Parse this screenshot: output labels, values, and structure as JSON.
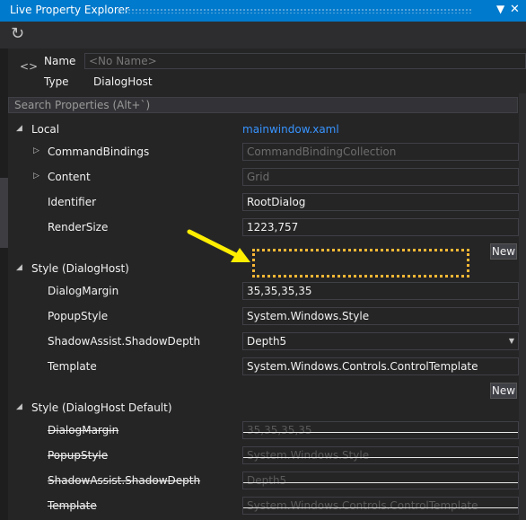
{
  "window": {
    "title": "Live Property Explorer"
  },
  "toolbar": {
    "refresh_icon": "refresh-icon"
  },
  "header": {
    "name_label": "Name",
    "name_placeholder": "<No Name>",
    "type_label": "Type",
    "type_value": "DialogHost"
  },
  "search": {
    "placeholder": "Search Properties (Alt+`)"
  },
  "local": {
    "label": "Local",
    "source_link": "mainwindow.xaml",
    "props": [
      {
        "name": "CommandBindings",
        "value": "CommandBindingCollection"
      },
      {
        "name": "Content",
        "value": "Grid"
      },
      {
        "name": "Identifier",
        "value": "RootDialog"
      },
      {
        "name": "RenderSize",
        "value": "1223,757"
      }
    ],
    "new_label": "New"
  },
  "style": {
    "label": "Style (DialogHost)",
    "props": [
      {
        "name": "DialogMargin",
        "value": "35,35,35,35"
      },
      {
        "name": "PopupStyle",
        "value": "System.Windows.Style"
      },
      {
        "name": "ShadowAssist.ShadowDepth",
        "value": "Depth5"
      },
      {
        "name": "Template",
        "value": "System.Windows.Controls.ControlTemplate"
      }
    ],
    "new_label": "New"
  },
  "style_default": {
    "label": "Style (DialogHost Default)",
    "props": [
      {
        "name": "DialogMargin",
        "value": "35,35,35,35"
      },
      {
        "name": "PopupStyle",
        "value": "System.Windows.Style"
      },
      {
        "name": "ShadowAssist.ShadowDepth",
        "value": "Depth5"
      },
      {
        "name": "Template",
        "value": "System.Windows.Controls.ControlTemplate"
      }
    ]
  },
  "colors": {
    "accent": "#007acc",
    "link": "#3794ff",
    "highlight": "#ffb834",
    "arrow": "#ffee00"
  }
}
